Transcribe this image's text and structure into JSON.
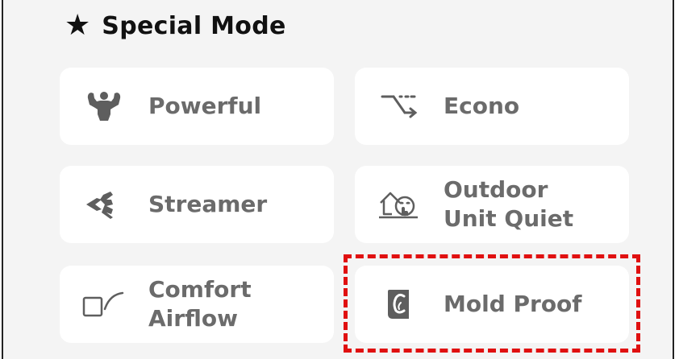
{
  "header": {
    "star_glyph": "★",
    "title": "Special Mode"
  },
  "modes": [
    {
      "label": "Powerful",
      "icon": "powerful-icon"
    },
    {
      "label": "Econo",
      "icon": "econo-icon"
    },
    {
      "label": "Streamer",
      "icon": "streamer-icon"
    },
    {
      "label": "Outdoor\nUnit Quiet",
      "icon": "outdoor-unit-quiet-icon"
    },
    {
      "label": "Comfort\nAirflow",
      "icon": "comfort-airflow-icon"
    },
    {
      "label": "Mold Proof",
      "icon": "mold-proof-icon"
    }
  ],
  "highlighted_mode": "Mold Proof",
  "colors": {
    "panel_background": "#f4f4f4",
    "card_background": "#ffffff",
    "label_text": "#6b6b6b",
    "icon": "#5e5e5e",
    "title_text": "#111111",
    "highlight_border": "#e01010"
  }
}
